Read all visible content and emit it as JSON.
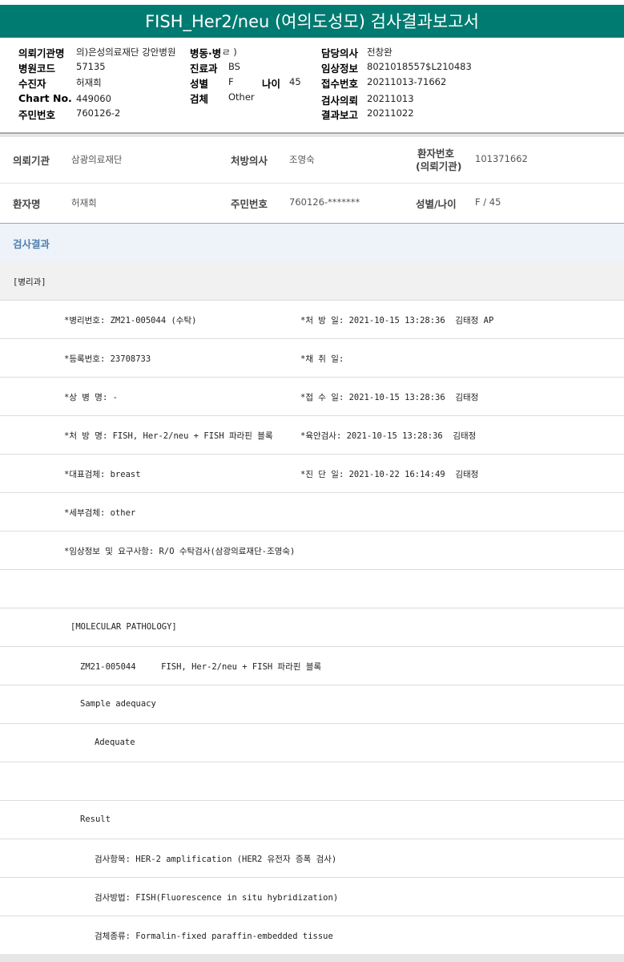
{
  "title": "FISH_Her2/neu (여의도성모) 검사결과보고서",
  "header": {
    "req_org_label": "의뢰기관명",
    "req_org_value": "의)은성의료재단 강안병원",
    "ward_label": "병동·병",
    "paren_close": "ㄹ )",
    "doctor_label": "담당의사",
    "doctor_value": "전창완",
    "hosp_code_label": "병원코드",
    "hosp_code_value": "57135",
    "dept_label": "진료과",
    "dept_value": "BS",
    "clinical_label": "임상정보",
    "clinical_value": "8021018557$L210483",
    "subject_label": "수진자",
    "subject_value": "허재희",
    "sex_label": "성별",
    "sex_value": "F",
    "age_label": "나이",
    "age_value": "45",
    "receipt_label": "접수번호",
    "receipt_value": "20211013-71662",
    "chart_label": "Chart No.",
    "chart_value": "449060",
    "specimen_label": "검체",
    "specimen_value": "Other",
    "request_date_label": "검사의뢰",
    "request_date_value": "20211013",
    "rrn_label": "주민번호",
    "rrn_value": "760126-2",
    "report_date_label": "결과보고",
    "report_date_value": "20211022"
  },
  "patient_info": {
    "req_org_label": "의뢰기관",
    "req_org_value": "삼광의료재단",
    "prescriber_label": "처방의사",
    "prescriber_value": "조영숙",
    "patient_no_label_1": "환자번호",
    "patient_no_label_2": "(의뢰기관)",
    "patient_no_value": "101371662",
    "name_label": "환자명",
    "name_value": "허재희",
    "rrn_label": "주민번호",
    "rrn_value": "760126-*******",
    "sexage_label": "성별/나이",
    "sexage_value": "F / 45"
  },
  "result_section": {
    "title": "검사결과"
  },
  "report_lines": [
    {
      "left": "[병리과]",
      "right": ""
    },
    {
      "left": "*병리번호: ZM21-005044 (수탁)",
      "right": "*처 방 일: 2021-10-15 13:28:36  김태정 AP"
    },
    {
      "left": "*등록번호: 23708733",
      "right": "*채 취 일:"
    },
    {
      "left": "*상 병 명: -",
      "right": "*접 수 일: 2021-10-15 13:28:36  김태정"
    },
    {
      "left": "*처 방 명: FISH, Her-2/neu + FISH 파라핀 블록",
      "right": "*육안검사: 2021-10-15 13:28:36  김태정"
    },
    {
      "left": "*대표검체: breast",
      "right": "*진 단 일: 2021-10-22 16:14:49  김태정"
    },
    {
      "left": "*세부검체: other",
      "right": ""
    },
    {
      "left": "*임상정보 및 요구사항: R/O 수탁검사(삼광의료재단-조영숙)",
      "right": ""
    },
    {
      "left": "",
      "right": ""
    },
    {
      "left": "[MOLECULAR PATHOLOGY]",
      "right": ""
    },
    {
      "left": "ZM21-005044     FISH, Her-2/neu + FISH 파라핀 블록",
      "right": ""
    },
    {
      "left": "Sample adequacy",
      "right": ""
    },
    {
      "left": "Adequate",
      "right": ""
    },
    {
      "left": "",
      "right": ""
    },
    {
      "left": "Result",
      "right": ""
    },
    {
      "left": "검사항목: HER-2 amplification (HER2 유전자 증폭 검사)",
      "right": ""
    },
    {
      "left": "검사방법: FISH(Fluorescence in situ hybridization)",
      "right": ""
    },
    {
      "left": "검체종류: Formalin-fixed paraffin-embedded tissue",
      "right": ""
    }
  ],
  "colors": {
    "title_bar": "#007b71",
    "section_title": "#4f7fae",
    "section_bg": "#edf3f9"
  }
}
